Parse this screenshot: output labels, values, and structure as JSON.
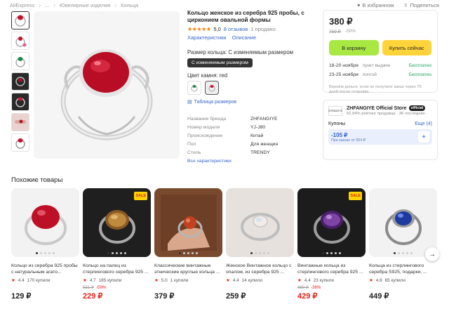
{
  "breadcrumb": [
    "AliExpress",
    "...",
    "Ювелирные изделия",
    "Кольца"
  ],
  "top_actions": {
    "favorites": "В избранном",
    "share": "Поделиться"
  },
  "product": {
    "title": "Кольцо женское из серебра 925 пробы, с цирконием овальной формы",
    "rating": "5,0",
    "reviews": "8 отзывов",
    "sold": "1 продано",
    "tab_specs": "Характеристики",
    "tab_desc": "Описание",
    "size_label": "Размер кольца: С изменяемым размером",
    "size_value": "С изменяемым размером",
    "color_label": "Цвет камня: red",
    "size_table": "Таблица размеров",
    "specs": [
      {
        "k": "Название бренда",
        "v": "ZHFANGIYE"
      },
      {
        "k": "Номер модели",
        "v": "YJ-J80"
      },
      {
        "k": "Происхождение",
        "v": "Китай"
      },
      {
        "k": "Пол",
        "v": "Для женщин"
      },
      {
        "k": "Стиль",
        "v": "TRENDY"
      }
    ],
    "all_specs": "Все характеристики"
  },
  "buy": {
    "price": "380 ₽",
    "old_price": "759 ₽",
    "discount": "-50%",
    "cart": "В корзину",
    "buy_now": "Купить сейчас",
    "delivery": [
      {
        "date": "18-20 ноября",
        "way": "пункт выдачи",
        "cost": "Бесплатно"
      },
      {
        "date": "23-25 ноября",
        "way": "почтой",
        "cost": "Бесплатно"
      }
    ],
    "returns": "Вернём деньги, если не получите заказ через 75 дней после отправки."
  },
  "store": {
    "logo": "ZHFANGIYE",
    "name": "ZHFANGIYE Official Store",
    "badge": "official",
    "rating": "92,94% рейтинг продавца · 3K последних",
    "coupons_label": "Купоны",
    "coupons_all": "Еще (4)",
    "coupon_amount": "-105 ₽",
    "coupon_cond": "При заказе от 954 ₽"
  },
  "similar": {
    "title": "Похожие товары",
    "items": [
      {
        "title": "Кольцо из серебра 925 пробы с натуральным агато...",
        "rating": "4.4",
        "sold": "170 купили",
        "old": "",
        "pct": "",
        "price": "129 ₽",
        "red": false,
        "sale": false
      },
      {
        "title": "Кольцо на палец из стерлингового серебра 925 ...",
        "rating": "4.7",
        "sold": "185 купили",
        "old": "551 ₽",
        "pct": "-59%",
        "price": "229 ₽",
        "red": true,
        "sale": true
      },
      {
        "title": "Классические винтажные этнические круглые кольца ...",
        "rating": "5.0",
        "sold": "1 купили",
        "old": "",
        "pct": "",
        "price": "379 ₽",
        "red": false,
        "sale": false
      },
      {
        "title": "Женское Винтажное кольцо с опалом, из серебра 925 ...",
        "rating": "4.4",
        "sold": "14 купили",
        "old": "",
        "pct": "",
        "price": "259 ₽",
        "red": false,
        "sale": false
      },
      {
        "title": "Винтажные кольца из стерлингового серебра 925 ...",
        "rating": "4.4",
        "sold": "23 купили",
        "old": "669 ₽",
        "pct": "-36%",
        "price": "429 ₽",
        "red": true,
        "sale": true
      },
      {
        "title": "Кольца из стерлингового серебра S925, подарки, ...",
        "rating": "4.8",
        "sold": "65 купили",
        "old": "",
        "pct": "",
        "price": "449 ₽",
        "red": false,
        "sale": false
      }
    ]
  },
  "colors": {
    "cart": "#a9e843",
    "buy": "#ffd43b",
    "price_red": "#e0221a",
    "link": "#3966c8"
  }
}
